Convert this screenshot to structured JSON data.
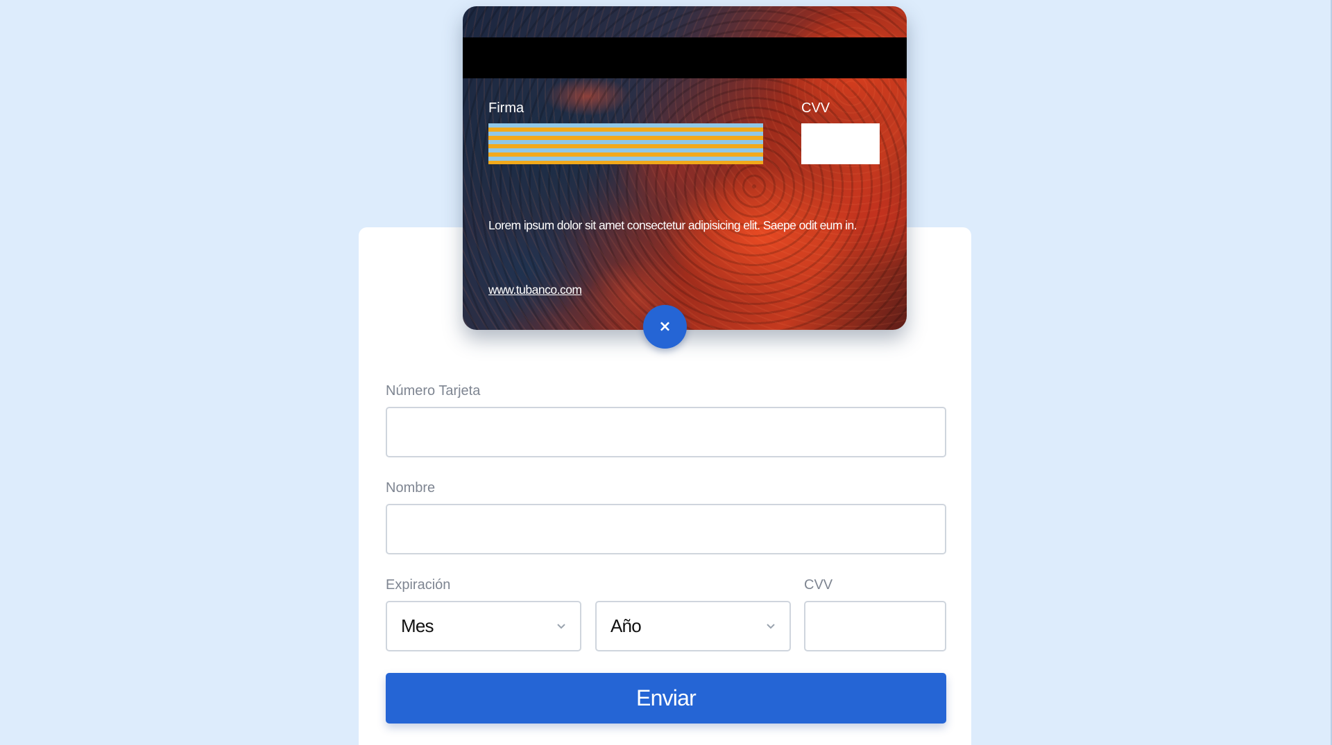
{
  "card": {
    "signature_label": "Firma",
    "cvv_label": "CVV",
    "disclaimer": "Lorem ipsum dolor sit amet consectetur adipisicing elit. Saepe odit eum in.",
    "website": "www.tubanco.com"
  },
  "close_button": {
    "symbol": "×",
    "icon": "close-icon"
  },
  "form": {
    "card_number": {
      "label": "Número Tarjeta",
      "value": ""
    },
    "name": {
      "label": "Nombre",
      "value": ""
    },
    "expiration": {
      "label": "Expiración",
      "month_selected": "Mes",
      "year_selected": "Año"
    },
    "cvv": {
      "label": "CVV",
      "value": ""
    },
    "submit_label": "Enviar"
  },
  "colors": {
    "background": "#ddecfc",
    "accent": "#2565d5",
    "input_border": "#cfd5dd",
    "label_text": "#7e8591"
  }
}
